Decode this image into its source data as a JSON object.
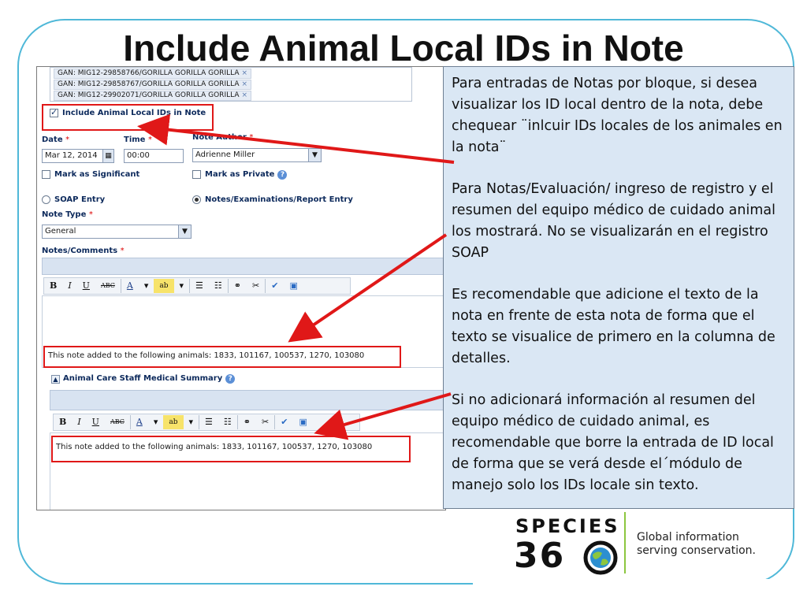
{
  "slide": {
    "title": "Include Animal Local IDs in Note"
  },
  "form": {
    "animal_chips": [
      "GAN: MIG12-29858766/GORILLA GORILLA GORILLA",
      "GAN: MIG12-29858767/GORILLA GORILLA GORILLA",
      "GAN: MIG12-29902071/GORILLA GORILLA GORILLA"
    ],
    "chip_remove": "×",
    "include_local_ids_label": "Include Animal Local IDs in Note",
    "date_label": "Date",
    "date_value": "Mar 12, 2014",
    "time_label": "Time",
    "time_value": "00:00",
    "note_author_label": "Note Author",
    "note_author_value": "Adrienne Miller",
    "required_mark": "*",
    "mark_significant_label": "Mark as Significant",
    "mark_private_label": "Mark as Private",
    "soap_entry_label": "SOAP Entry",
    "notes_entry_label": "Notes/Examinations/Report Entry",
    "note_type_label": "Note Type",
    "note_type_value": "General",
    "notes_comments_label": "Notes/Comments",
    "notes_text": "This note added to the following animals: 1833, 101167, 100537, 1270, 103080",
    "staff_summary_label": "Animal Care Staff Medical Summary",
    "summary_text": "This note added to the following animals: 1833, 101167, 100537, 1270, 103080",
    "toolbar": {
      "bold": "B",
      "italic": "I",
      "underline": "U",
      "strike": "ABC",
      "font_color": "A",
      "highlight": "ab",
      "dropdown": "▾",
      "bullets": "☰",
      "numbered": "☷",
      "link": "⚭",
      "unlink": "✂",
      "spell": "✔",
      "source": "▣"
    },
    "help": "?"
  },
  "callout": {
    "paragraphs": [
      "Para entradas de Notas por bloque, si desea visualizar los ID local dentro de la nota, debe chequear ¨inlcuir IDs locales de  los animales en la nota¨",
      "Para Notas/Evaluación/ ingreso de registro y el resumen del equipo  médico de cuidado animal los mostrará. No se visualizarán en el registro SOAP",
      "Es recomendable  que adicione el texto de la nota en frente de esta nota de forma que el texto se visualice de primero en la columna de detalles.",
      "Si no adicionará información al resumen del equipo médico de cuidado animal, es recomendable que borre la entrada de ID local de forma que se verá desde el´módulo de manejo solo los IDs locale sin texto."
    ]
  },
  "logo": {
    "word": "SPECIES",
    "number_left": "36",
    "tagline_1": "Global information",
    "tagline_2": "serving conservation."
  },
  "colors": {
    "frame": "#4fb8d8",
    "highlight_box": "#e01818",
    "arrow": "#e01818",
    "callout_bg": "#dae7f4",
    "logo_accent": "#8cc63f"
  }
}
